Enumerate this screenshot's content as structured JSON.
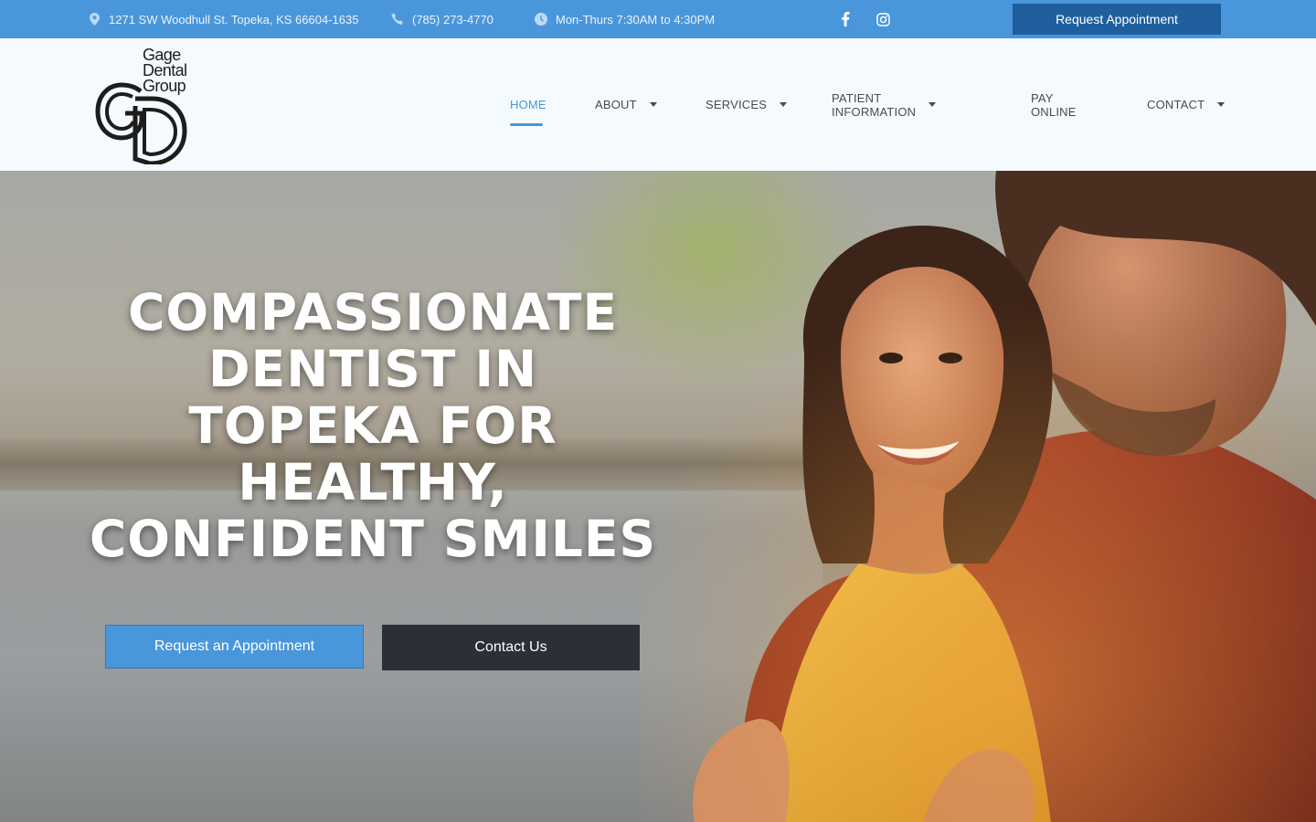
{
  "topbar": {
    "address": "1271 SW Woodhull St. Topeka, KS 66604-1635",
    "phone": "(785) 273-4770",
    "hours": "Mon-Thurs 7:30AM to 4:30PM",
    "social": [
      "facebook-icon",
      "instagram-icon"
    ],
    "cta_label": "Request Appointment"
  },
  "logo": {
    "line1": "Gage",
    "line2": "Dental",
    "line3": "Group"
  },
  "nav": {
    "items": [
      {
        "label": "HOME",
        "active": true,
        "dropdown": false
      },
      {
        "label": "ABOUT",
        "active": false,
        "dropdown": true
      },
      {
        "label": "SERVICES",
        "active": false,
        "dropdown": true
      },
      {
        "label": "PATIENT INFORMATION",
        "active": false,
        "dropdown": true
      },
      {
        "label": "PAY ONLINE",
        "active": false,
        "dropdown": false
      },
      {
        "label": "CONTACT",
        "active": false,
        "dropdown": true
      }
    ]
  },
  "hero": {
    "title_lines": [
      "COMPASSIONATE",
      "DENTIST IN",
      "TOPEKA FOR",
      "HEALTHY,",
      "CONFIDENT SMILES"
    ],
    "primary_button": "Request an Appointment",
    "secondary_button": "Contact Us"
  },
  "colors": {
    "brand_blue": "#4a96db",
    "dark_blue": "#1f5f9e",
    "dark_button": "#2c2f38"
  }
}
